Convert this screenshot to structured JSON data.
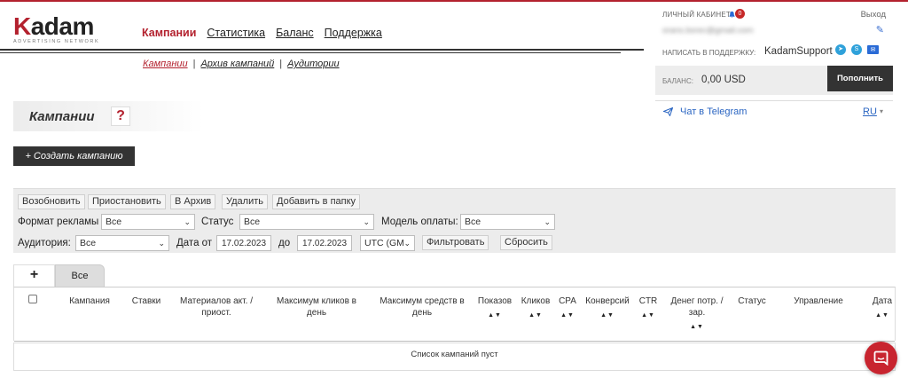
{
  "logo": {
    "first": "K",
    "rest": "adam",
    "tagline": "ADVERTISING NETWORK"
  },
  "topnav": [
    "Кампании",
    "Статистика",
    "Баланс",
    "Поддержка"
  ],
  "subnav": {
    "items": [
      "Кампании",
      "Архив кампаний",
      "Аудитории"
    ],
    "sep": "|"
  },
  "page": {
    "title": "Кампании",
    "help": "?",
    "create_label": "+ Создать кампанию"
  },
  "account": {
    "cabinet_label": "ЛИЧНЫЙ КАБИНЕТ",
    "notifications": "0",
    "logout": "Выход",
    "email": "orans.bsrec@gmail.com",
    "support_label": "НАПИСАТЬ В ПОДДЕРЖКУ:",
    "support_name": "KadamSupport",
    "balance_label": "БАЛАНС:",
    "balance_value": "0,00 USD",
    "topup": "Пополнить",
    "telegram": "Чат в Telegram",
    "lang": "RU"
  },
  "actions": [
    "Возобновить",
    "Приостановить",
    "В Архив",
    "Удалить",
    "Добавить в папку"
  ],
  "filters": {
    "format_label": "Формат рекламы",
    "format_value": "Все",
    "status_label": "Статус",
    "status_value": "Все",
    "payment_label": "Модель оплаты:",
    "payment_value": "Все",
    "audience_label": "Аудитория:",
    "audience_value": "Все",
    "date_from_label": "Дата от",
    "date_from": "17.02.2023",
    "date_to_label": "до",
    "date_to": "17.02.2023",
    "tz": "UTC (GM",
    "filter_btn": "Фильтровать",
    "reset_btn": "Сбросить"
  },
  "tabs": {
    "add": "+",
    "all": "Все"
  },
  "table": {
    "columns": [
      "Кампания",
      "Ставки",
      "Материалов акт. / приост.",
      "Максимум кликов в день",
      "Максимум средств в день",
      "Показов",
      "Кликов",
      "CPA",
      "Конверсий",
      "CTR",
      "Денег потр. / зар.",
      "Статус",
      "Управление",
      "Дата"
    ],
    "sort_glyph": "▲▼",
    "empty": "Список кампаний пуст"
  }
}
